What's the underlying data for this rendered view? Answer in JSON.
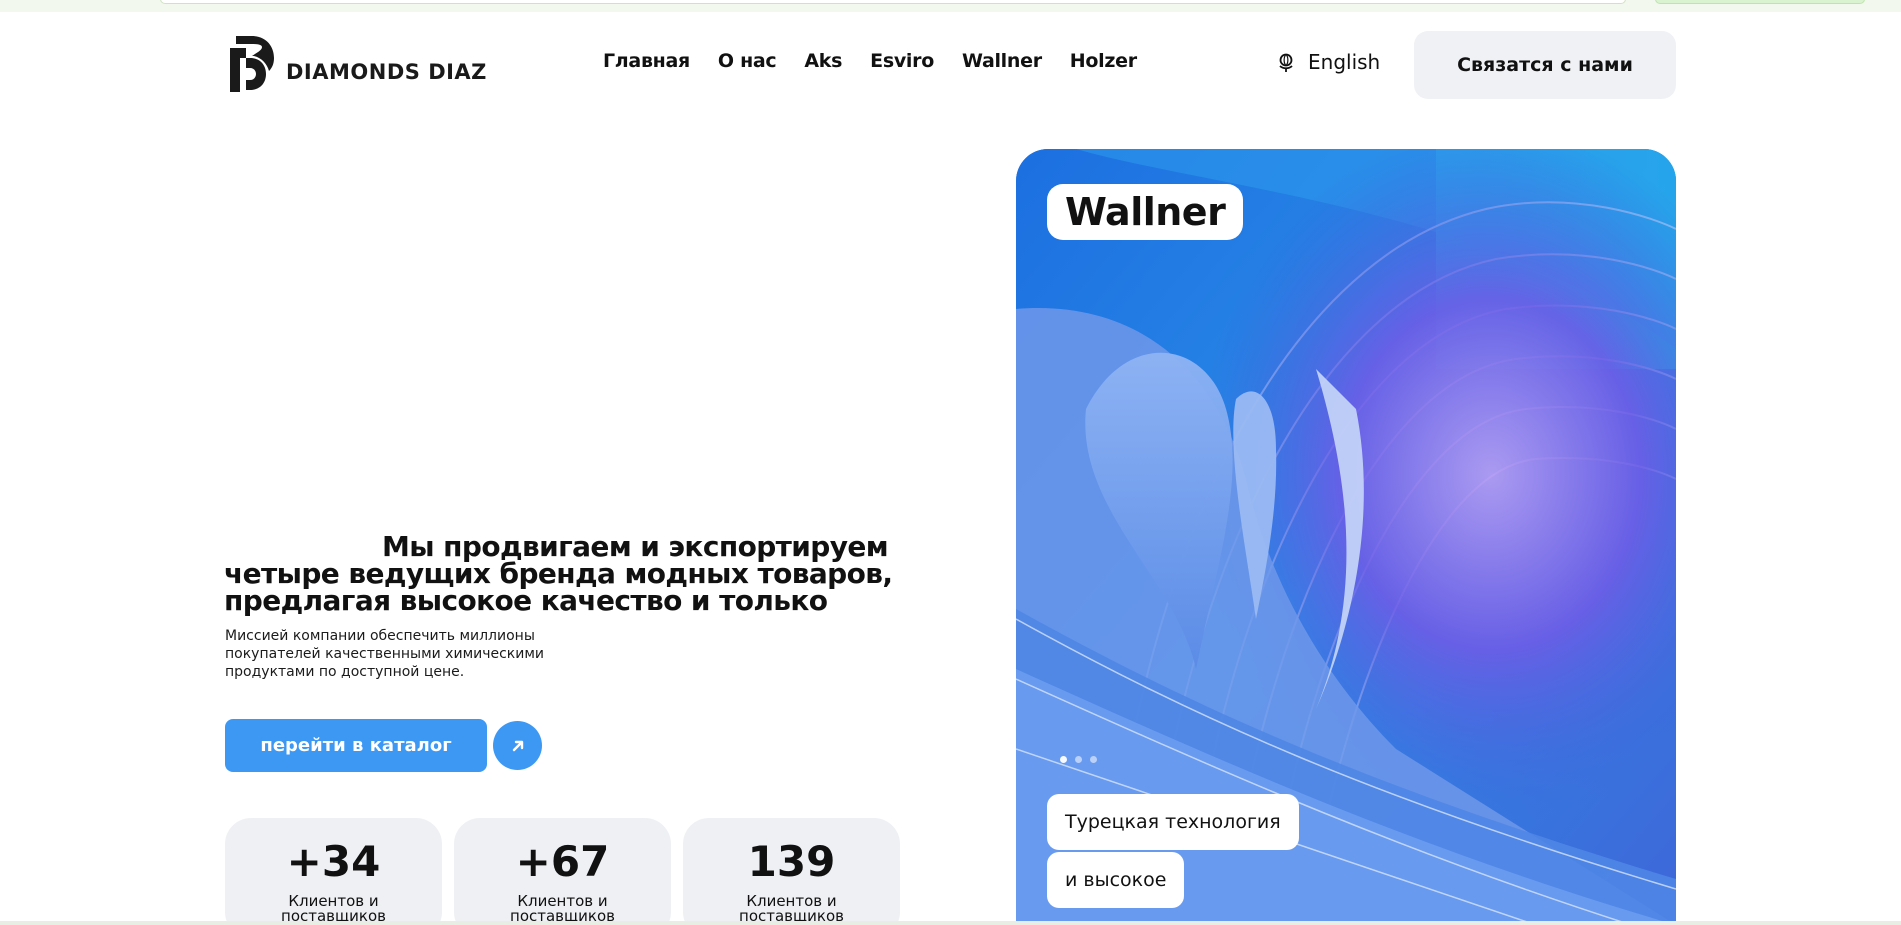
{
  "brand": {
    "name": "DIAMONDS DIAZ",
    "logo_icon": "dd-monogram-icon"
  },
  "nav": {
    "items": [
      {
        "label": "Главная"
      },
      {
        "label": "О нас"
      },
      {
        "label": "Aks"
      },
      {
        "label": "Esviro"
      },
      {
        "label": "Wallner"
      },
      {
        "label": "Holzer"
      }
    ]
  },
  "language": {
    "label": "English",
    "icon": "globe-icon"
  },
  "contact_button": {
    "label": "Связатся с нами"
  },
  "hero": {
    "headline_lines": [
      "Мы продвигаем и экспортируем",
      "четыре ведущих бренда модных товаров,",
      "предлагая высокое качество и только"
    ],
    "description": "Миссией компании обеспечить миллионы покупателей качественными химическими продуктами по доступной цене.",
    "catalog_button": "перейти в каталог",
    "arrow_icon": "arrow-up-right-icon"
  },
  "stats": [
    {
      "value": "+34",
      "label": "Клиентов и поставщиков"
    },
    {
      "value": "+67",
      "label": "Клиентов и поставщиков"
    },
    {
      "value": "139",
      "label": "Клиентов и поставщиков"
    }
  ],
  "card": {
    "title": "Wallner",
    "slides": 3,
    "active_slide": 1,
    "tags": [
      "Турецкая технология",
      "и высокое"
    ]
  },
  "colors": {
    "accent": "#3d98f4",
    "button_bg": "#f0f1f4",
    "stat_bg": "#eef0f3",
    "card_blue": "#3a7fe0",
    "card_purple": "#7a5ce8"
  }
}
